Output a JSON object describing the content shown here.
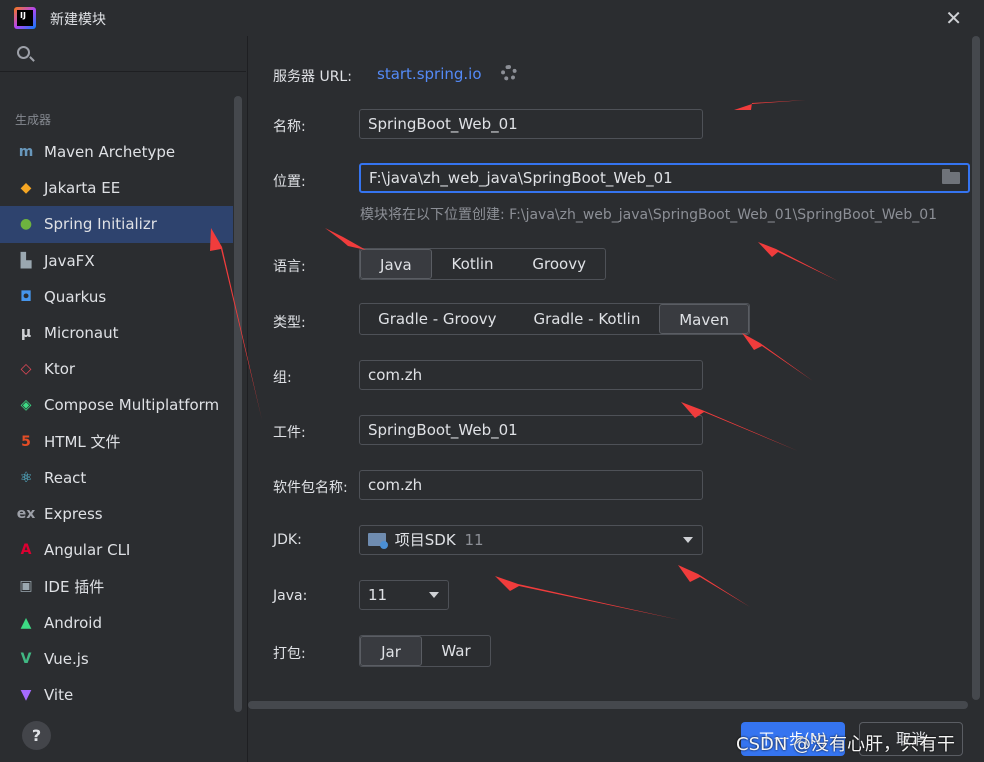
{
  "window": {
    "title": "新建模块",
    "close_glyph": "✕"
  },
  "sidebar": {
    "group_label": "生成器",
    "items": [
      {
        "label": "Maven Archetype",
        "icon": "maven-icon",
        "glyph": "m",
        "color": "#6897bb"
      },
      {
        "label": "Jakarta EE",
        "icon": "jakarta-icon",
        "glyph": "◆",
        "color": "#f5a623"
      },
      {
        "label": "Spring Initializr",
        "icon": "spring-icon",
        "glyph": "●",
        "color": "#6db33f"
      },
      {
        "label": "JavaFX",
        "icon": "javafx-icon",
        "glyph": "▙",
        "color": "#9aa7b0"
      },
      {
        "label": "Quarkus",
        "icon": "quarkus-icon",
        "glyph": "◘",
        "color": "#4695eb"
      },
      {
        "label": "Micronaut",
        "icon": "micronaut-icon",
        "glyph": "μ",
        "color": "#cfd1d5"
      },
      {
        "label": "Ktor",
        "icon": "ktor-icon",
        "glyph": "◇",
        "color": "#e44857"
      },
      {
        "label": "Compose Multiplatform",
        "icon": "compose-icon",
        "glyph": "◈",
        "color": "#3ddc84"
      },
      {
        "label": "HTML 文件",
        "icon": "html5-icon",
        "glyph": "5",
        "color": "#e44d26"
      },
      {
        "label": "React",
        "icon": "react-icon",
        "glyph": "⚛",
        "color": "#61dafb"
      },
      {
        "label": "Express",
        "icon": "express-icon",
        "glyph": "ex",
        "color": "#9da0a8"
      },
      {
        "label": "Angular CLI",
        "icon": "angular-icon",
        "glyph": "A",
        "color": "#dd0031"
      },
      {
        "label": "IDE 插件",
        "icon": "plugin-icon",
        "glyph": "▣",
        "color": "#9aa7b0"
      },
      {
        "label": "Android",
        "icon": "android-icon",
        "glyph": "▲",
        "color": "#3ddc84"
      },
      {
        "label": "Vue.js",
        "icon": "vue-icon",
        "glyph": "V",
        "color": "#41b883"
      },
      {
        "label": "Vite",
        "icon": "vite-icon",
        "glyph": "▼",
        "color": "#a66bff"
      }
    ],
    "selected_index": 2,
    "help_label": "?"
  },
  "form": {
    "server_url_label": "服务器 URL:",
    "server_url": "start.spring.io",
    "name_label": "名称:",
    "name_value": "SpringBoot_Web_01",
    "location_label": "位置:",
    "location_value": "F:\\java\\zh_web_java\\SpringBoot_Web_01",
    "location_hint": "模块将在以下位置创建: F:\\java\\zh_web_java\\SpringBoot_Web_01\\SpringBoot_Web_01",
    "language_label": "语言:",
    "languages": [
      "Java",
      "Kotlin",
      "Groovy"
    ],
    "language_selected": "Java",
    "type_label": "类型:",
    "types": [
      "Gradle - Groovy",
      "Gradle - Kotlin",
      "Maven"
    ],
    "type_selected": "Maven",
    "group_label": "组:",
    "group_value": "com.zh",
    "artifact_label": "工件:",
    "artifact_value": "SpringBoot_Web_01",
    "package_label": "软件包名称:",
    "package_value": "com.zh",
    "jdk_label": "JDK:",
    "jdk_value": "项目SDK",
    "jdk_version": "11",
    "java_label": "Java:",
    "java_value": "11",
    "packaging_label": "打包:",
    "packaging": [
      "Jar",
      "War"
    ],
    "packaging_selected": "Jar"
  },
  "footer": {
    "next_label": "下一步(N)",
    "cancel_label": "取消"
  },
  "watermark": "CSDN @没有心肝，只有干",
  "colors": {
    "accent": "#3574f0",
    "selection": "#2e436e",
    "link": "#548af7",
    "arrow": "#f03c3c"
  }
}
